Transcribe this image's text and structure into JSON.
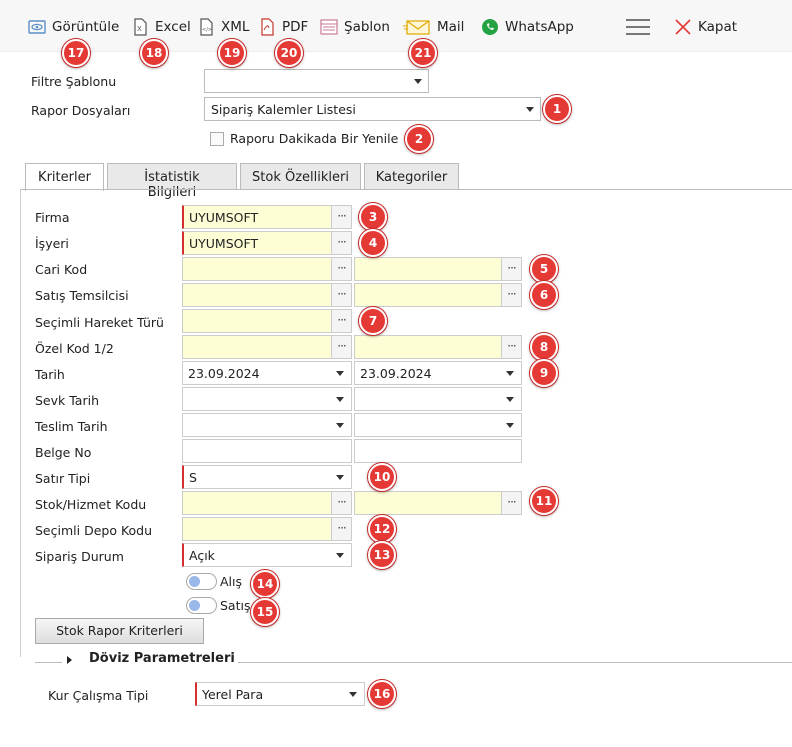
{
  "toolbar": {
    "items": [
      {
        "label": "Görüntüle",
        "icon": "view-icon"
      },
      {
        "label": "Excel",
        "icon": "excel-icon"
      },
      {
        "label": "XML",
        "icon": "xml-icon"
      },
      {
        "label": "PDF",
        "icon": "pdf-icon"
      },
      {
        "label": "Şablon",
        "icon": "template-icon"
      },
      {
        "label": "Mail",
        "icon": "mail-icon"
      },
      {
        "label": "WhatsApp",
        "icon": "whatsapp-icon"
      },
      {
        "label": "Kapat",
        "icon": "close-icon"
      }
    ]
  },
  "header": {
    "filter_template_label": "Filtre Şablonu",
    "filter_template_value": "",
    "report_files_label": "Rapor Dosyaları",
    "report_files_value": "Sipariş Kalemler Listesi",
    "refresh_label": "Raporu Dakikada Bir Yenile"
  },
  "tabs": [
    "Kriterler",
    "İstatistik Bilgileri",
    "Stok Özellikleri",
    "Kategoriler"
  ],
  "form": {
    "firma_label": "Firma",
    "firma_value": "UYUMSOFT",
    "isyeri_label": "İşyeri",
    "isyeri_value": "UYUMSOFT",
    "cari_kod_label": "Cari Kod",
    "satis_temsilcisi_label": "Satış Temsilcisi",
    "hareket_turu_label": "Seçimli Hareket Türü",
    "ozel_kod_label": "Özel Kod 1/2",
    "tarih_label": "Tarih",
    "tarih_from": "23.09.2024",
    "tarih_to": "23.09.2024",
    "sevk_tarih_label": "Sevk Tarih",
    "teslim_tarih_label": "Teslim Tarih",
    "belge_no_label": "Belge No",
    "satir_tipi_label": "Satır Tipi",
    "satir_tipi_value": "S",
    "stok_kodu_label": "Stok/Hizmet Kodu",
    "depo_kodu_label": "Seçimli Depo Kodu",
    "siparis_durum_label": "Sipariş Durum",
    "siparis_durum_value": "Açık",
    "alis_label": "Alış",
    "satis_label": "Satış",
    "stok_rapor_button": "Stok Rapor Kriterleri",
    "doviz_title": "Döviz Parametreleri",
    "kur_label": "Kur Çalışma Tipi",
    "kur_value": "Yerel Para"
  },
  "badges": [
    "1",
    "2",
    "3",
    "4",
    "5",
    "6",
    "7",
    "8",
    "9",
    "10",
    "11",
    "12",
    "13",
    "14",
    "15",
    "16",
    "17",
    "18",
    "19",
    "20",
    "21"
  ],
  "dots": "···",
  "colors": {
    "badge": "#e53935",
    "field_bg": "#fefed6",
    "required_border": "#d32f2f"
  }
}
